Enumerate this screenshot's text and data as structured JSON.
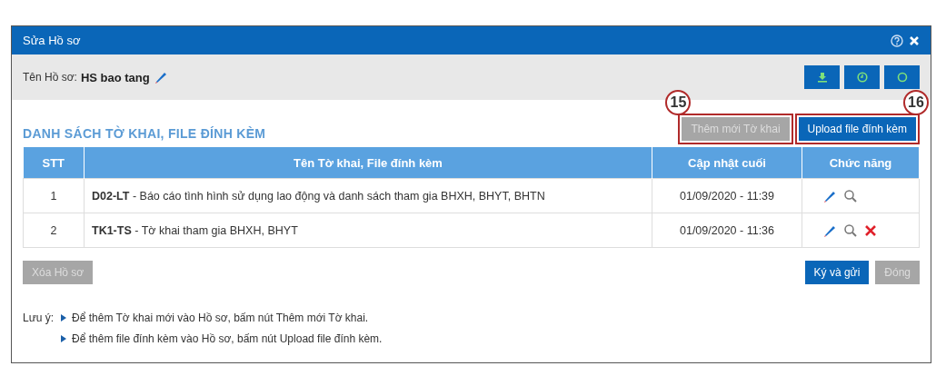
{
  "window": {
    "title": "Sửa Hồ sơ"
  },
  "header": {
    "label": "Tên Hồ sơ:",
    "value": "HS bao tang"
  },
  "toolbar_buttons": [
    {
      "kind": "download"
    },
    {
      "kind": "clock"
    },
    {
      "kind": "settings"
    }
  ],
  "section": {
    "title": "DANH SÁCH TỜ KHAI, FILE ĐÍNH KÈM"
  },
  "section_buttons": [
    {
      "label": "Thêm mới Tờ khai",
      "disabled": true,
      "highlighted": true,
      "callout": "15"
    },
    {
      "label": "Upload file đính kèm",
      "disabled": false,
      "highlighted": true,
      "callout": "16"
    }
  ],
  "table": {
    "columns": [
      "STT",
      "Tên Tờ khai, File đính kèm",
      "Cập nhật cuối",
      "Chức năng"
    ],
    "rows": [
      {
        "stt": "1",
        "code": "D02-LT",
        "name": " - Báo cáo tình hình sử dụng lao động và danh sách tham gia BHXH, BHYT, BHTN",
        "updated": "01/09/2020 - 11:39",
        "actions": [
          {
            "kind": "edit"
          },
          {
            "kind": "view"
          }
        ]
      },
      {
        "stt": "2",
        "code": "TK1-TS",
        "name": " - Tờ khai tham gia BHXH, BHYT",
        "updated": "01/09/2020 - 11:36",
        "actions": [
          {
            "kind": "edit"
          },
          {
            "kind": "view"
          },
          {
            "kind": "delete"
          }
        ]
      }
    ]
  },
  "footer_left": [
    {
      "label": "Xóa Hồ sơ",
      "disabled": true
    }
  ],
  "footer_right": [
    {
      "label": "Ký và gửi",
      "disabled": false
    },
    {
      "label": "Đóng",
      "disabled": true
    }
  ],
  "notes": {
    "label": "Lưu ý:",
    "items": [
      "Để thêm Tờ khai mới vào Hồ sơ, bấm nút Thêm mới Tờ khai.",
      "Để thêm file đính kèm vào Hồ sơ, bấm nút Upload file đính kèm."
    ]
  }
}
